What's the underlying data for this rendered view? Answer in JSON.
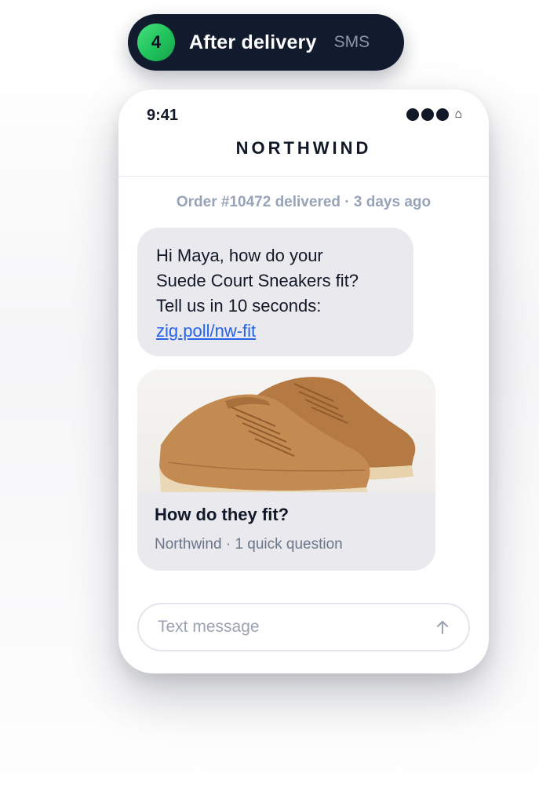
{
  "step": {
    "number": "4",
    "title": "After delivery",
    "channel": "SMS"
  },
  "phone": {
    "status_time": "9:41",
    "brand": "NORTHWIND",
    "meta": "Order #10472 delivered · 3 days ago",
    "message": {
      "line1": "Hi Maya, how do your",
      "line2": "Suede Court Sneakers fit?",
      "line3": "Tell us in 10 seconds:",
      "link": "zig.poll/nw-fit"
    },
    "card": {
      "title": "How do they fit?",
      "subtitle": "Northwind · 1 quick question",
      "image": "suede-sneakers-product-image"
    },
    "composer": {
      "placeholder": "Text message"
    }
  },
  "icons": {
    "signal": "signal-dots-icon",
    "home": "home-icon",
    "send": "send-arrow-icon"
  },
  "colors": {
    "pill_bg": "#121a2e",
    "badge_green": "#22c55e",
    "bubble_bg": "#e9e9ee",
    "link": "#2563eb"
  }
}
